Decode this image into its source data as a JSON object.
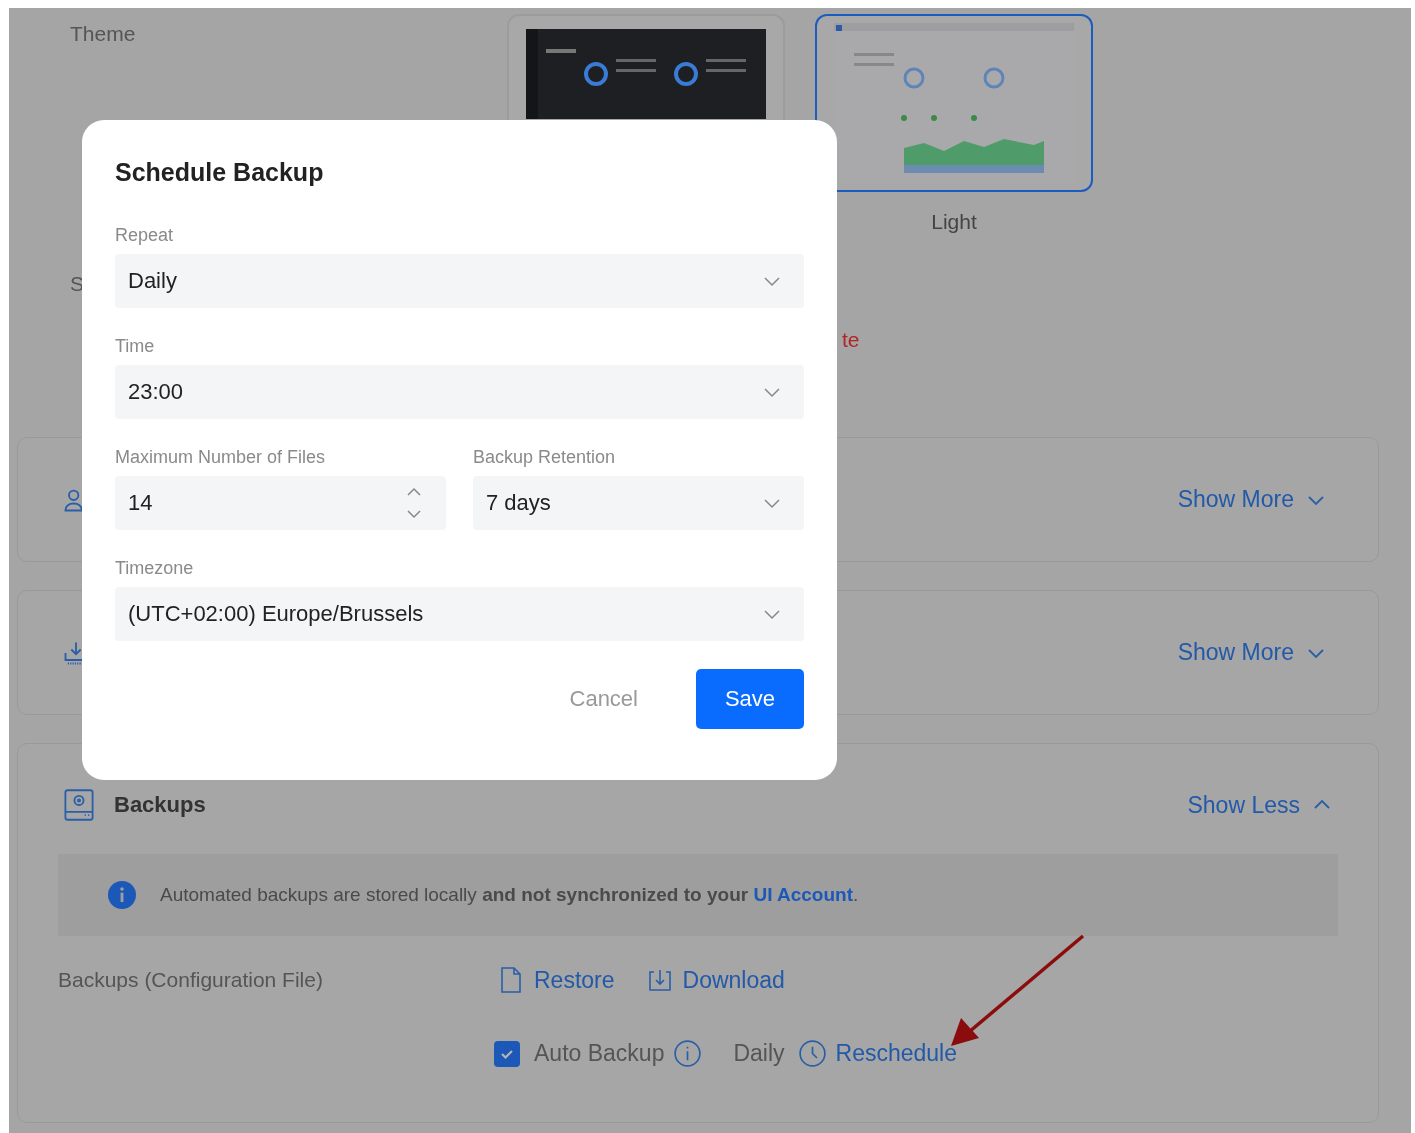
{
  "theme": {
    "label": "Theme",
    "options": [
      {
        "kind": "dark",
        "selected": false
      },
      {
        "kind": "light",
        "label": "Light",
        "selected": true
      }
    ]
  },
  "settings_row": {
    "label": "S",
    "action": "te"
  },
  "cards": [
    {
      "action": "Show More",
      "expanded": false
    },
    {
      "action": "Show More",
      "expanded": false
    }
  ],
  "backups": {
    "title": "Backups",
    "action": "Show Less",
    "expanded": true,
    "notice": {
      "text": "Automated backups are stored locally **and not synchronized to your**",
      "link": "UI Account",
      "end": "."
    },
    "config_label": "Backups (Configuration File)",
    "restore": "Restore",
    "download": "Download",
    "auto_backup": {
      "label": "Auto Backup",
      "checked": true
    },
    "schedule": "Daily",
    "reschedule": "Reschedule"
  },
  "dialog": {
    "title": "Schedule Backup",
    "rows": [
      [
        {
          "kind": "select",
          "label": "Repeat",
          "value": "Daily"
        }
      ],
      [
        {
          "kind": "select",
          "label": "Time",
          "value": "23:00"
        }
      ],
      [
        {
          "kind": "number",
          "label": "Maximum Number of Files",
          "value": "14"
        },
        {
          "kind": "select",
          "label": "Backup Retention",
          "value": "7 days"
        }
      ],
      [
        {
          "kind": "select",
          "label": "Timezone",
          "value": "(UTC+02:00) Europe/Brussels"
        }
      ]
    ],
    "cancel": "Cancel",
    "save": "Save"
  }
}
